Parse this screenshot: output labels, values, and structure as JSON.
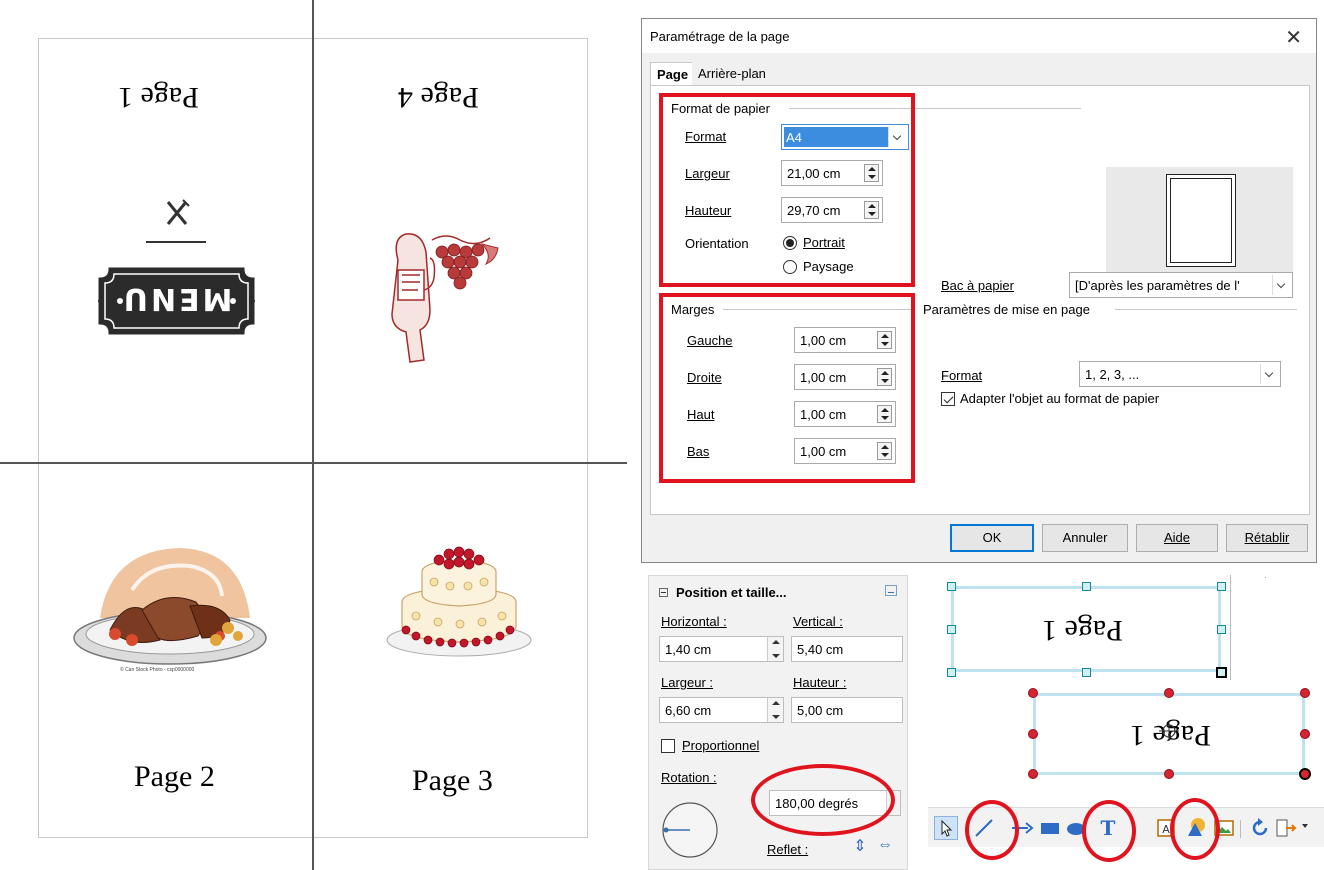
{
  "menu_sheet": {
    "panel_top_left": "Page 1",
    "panel_top_right": "Page 4",
    "panel_bottom_left": "Page 2",
    "panel_bottom_right": "Page 3",
    "badge_text": "MENU",
    "roast_caption": "© Can Stock Photo - csp0000000"
  },
  "dialog": {
    "title": "Paramétrage de la page",
    "tabs": [
      {
        "label": "Page"
      },
      {
        "label": "Arrière-plan"
      }
    ],
    "paper_format": {
      "group_label": "Format de papier",
      "format_label": "Format",
      "format_value": "A4",
      "width_label": "Largeur",
      "width_value": "21,00 cm",
      "height_label": "Hauteur",
      "height_value": "29,70 cm",
      "orientation_label": "Orientation",
      "portrait_label": "Portrait",
      "landscape_label": "Paysage",
      "orientation_selected": "Portrait"
    },
    "paper_tray": {
      "label": "Bac à papier",
      "value": "[D'après les paramètres de l'"
    },
    "margins": {
      "group_label": "Marges",
      "left_label": "Gauche",
      "left_value": "1,00 cm",
      "right_label": "Droite",
      "right_value": "1,00 cm",
      "top_label": "Haut",
      "top_value": "1,00 cm",
      "bottom_label": "Bas",
      "bottom_value": "1,00 cm"
    },
    "layout_settings": {
      "group_label": "Paramètres de mise en page",
      "format_label": "Format",
      "format_value": "1, 2, 3, ...",
      "fit_label": "Adapter l'objet au format de papier",
      "fit_checked": true
    },
    "buttons": {
      "ok": "OK",
      "cancel": "Annuler",
      "help": "Aide",
      "reset": "Rétablir"
    }
  },
  "sidebar": {
    "title": "Position et taille...",
    "horizontal_label": "Horizontal :",
    "horizontal_value": "1,40 cm",
    "vertical_label": "Vertical :",
    "vertical_value": "5,40 cm",
    "width_label": "Largeur :",
    "width_value": "6,60 cm",
    "height_label": "Hauteur :",
    "height_value": "5,00 cm",
    "proportional_label": "Proportionnel",
    "rotation_label": "Rotation :",
    "rotation_value": "180,00 degrés",
    "mirror_label": "Reflet :"
  },
  "canvas": {
    "box1_text": "Page 1",
    "box2_text": "Page 1"
  },
  "toolbar": {
    "icons": [
      "select-arrow-icon",
      "line-icon",
      "arrow-line-icon",
      "rectangle-icon",
      "ellipse-icon",
      "text-icon",
      "fontwork-icon",
      "shapes-icon",
      "image-icon",
      "rotate-icon",
      "align-icon"
    ],
    "text_tool_glyph": "T"
  },
  "colors": {
    "highlight_red": "#e0141e",
    "selection_teal": "#148a95",
    "handle_red": "#d62431",
    "ok_button_border": "#0078d7"
  }
}
